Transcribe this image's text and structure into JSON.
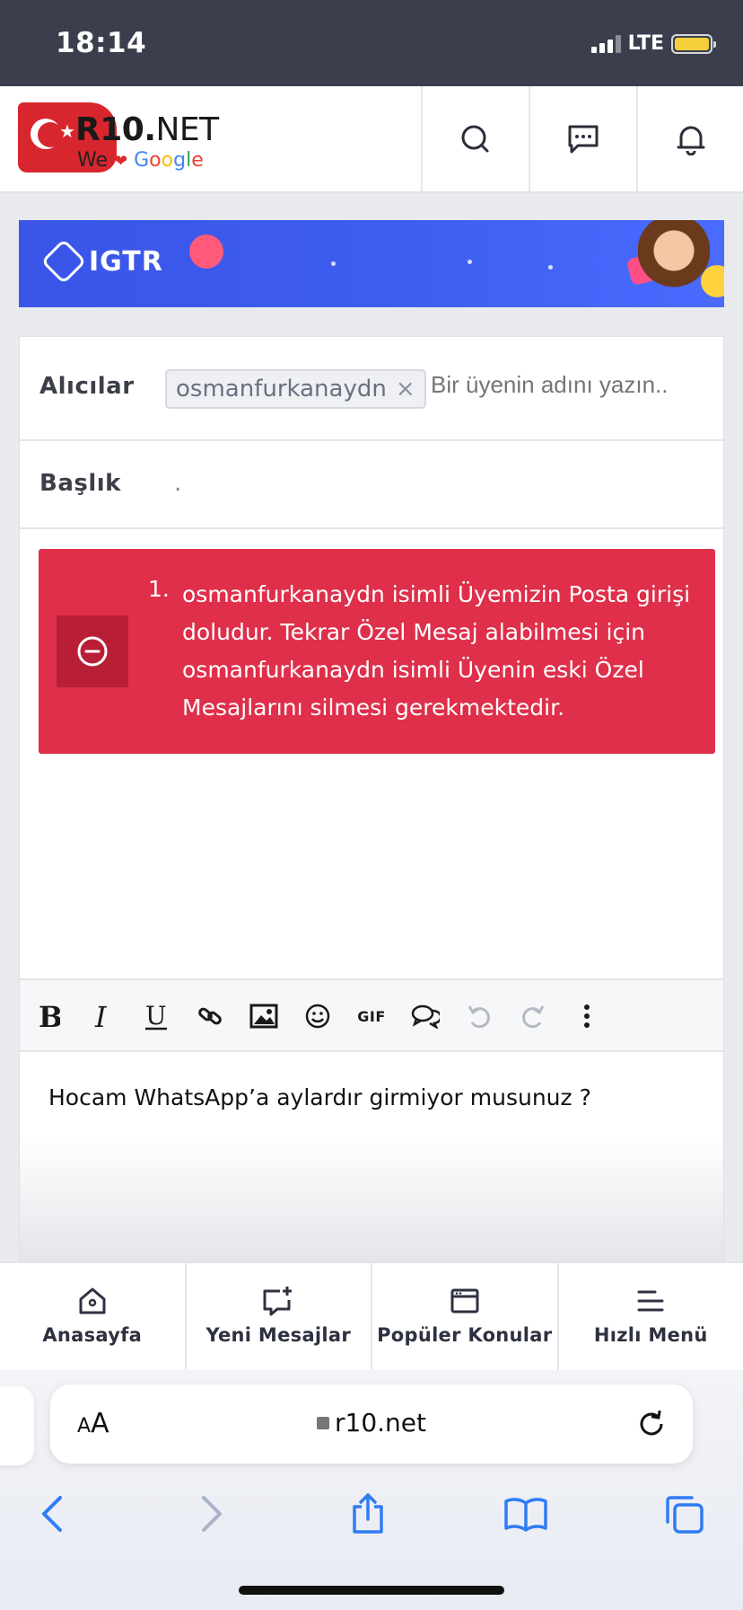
{
  "status": {
    "time": "18:14",
    "network": "LTE"
  },
  "header": {
    "brand_bold": "R10.",
    "brand_light": "NET",
    "tag_we": "We",
    "tag_google": [
      "G",
      "o",
      "o",
      "g",
      "l",
      "e"
    ]
  },
  "banner": {
    "brand": "IGTR"
  },
  "form": {
    "recipients_label": "Alıcılar",
    "recipient_chip": "osmanfurkanaydn",
    "recipient_placeholder": "Bir üyenin adını yazın..",
    "subject_label": "Başlık",
    "subject_value": "."
  },
  "error": {
    "number": "1.",
    "message": "osmanfurkanaydn isimli Üyemizin Posta girişi doludur. Tekrar Özel Mesaj alabilmesi için osmanfurkanaydn isimli Üyenin eski Özel Mesajlarını silmesi gerekmektedir."
  },
  "toolbar": {
    "gif_label": "GIF"
  },
  "editor": {
    "text": "Hocam WhatsApp’a aylardır girmiyor musunuz ?"
  },
  "bottom_nav": {
    "items": [
      {
        "label": "Anasayfa",
        "icon": "home-icon"
      },
      {
        "label": "Yeni Mesajlar",
        "icon": "new-message-icon"
      },
      {
        "label": "Popüler Konular",
        "icon": "window-icon"
      },
      {
        "label": "Hızlı Menü",
        "icon": "menu-icon"
      }
    ]
  },
  "safari": {
    "aa_small": "A",
    "aa_large": "A",
    "url": "r10.net"
  },
  "colors": {
    "error": "#df2f4a",
    "status_bar": "#3b3f4d",
    "banner": "#3d5cf0"
  }
}
